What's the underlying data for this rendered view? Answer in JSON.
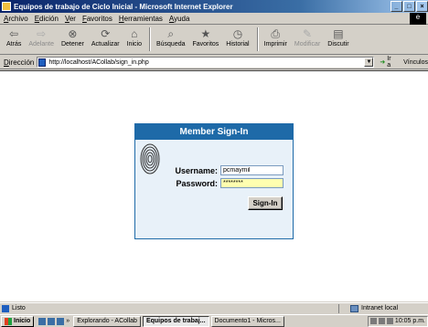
{
  "window": {
    "title": "Equipos de trabajo de Ciclo Inicial - Microsoft Internet Explorer",
    "controls": [
      "_",
      "□",
      "×"
    ]
  },
  "menu": [
    "Archivo",
    "Edición",
    "Ver",
    "Favoritos",
    "Herramientas",
    "Ayuda"
  ],
  "toolbar": [
    {
      "label": "Atrás",
      "icon": "back-arrow-icon",
      "glyph": "⇦",
      "enabled": true
    },
    {
      "label": "Adelante",
      "icon": "forward-arrow-icon",
      "glyph": "⇨",
      "enabled": false
    },
    {
      "label": "Detener",
      "icon": "stop-icon",
      "glyph": "⊗",
      "enabled": true
    },
    {
      "label": "Actualizar",
      "icon": "refresh-icon",
      "glyph": "⟳",
      "enabled": true
    },
    {
      "label": "Inicio",
      "icon": "home-icon",
      "glyph": "⌂",
      "enabled": true
    },
    {
      "label": "Búsqueda",
      "icon": "search-icon",
      "glyph": "⌕",
      "enabled": true
    },
    {
      "label": "Favoritos",
      "icon": "favorites-icon",
      "glyph": "★",
      "enabled": true
    },
    {
      "label": "Historial",
      "icon": "history-icon",
      "glyph": "◷",
      "enabled": true
    },
    {
      "label": "Imprimir",
      "icon": "print-icon",
      "glyph": "⎙",
      "enabled": true
    },
    {
      "label": "Modificar",
      "icon": "edit-icon",
      "glyph": "✎",
      "enabled": false
    },
    {
      "label": "Discutir",
      "icon": "discuss-icon",
      "glyph": "▤",
      "enabled": true
    }
  ],
  "address": {
    "label": "Dirección",
    "url": "http://localhost/ACollab/sign_in.php",
    "go_label": "Ir a",
    "links_label": "Vínculos"
  },
  "signin": {
    "title": "Member Sign-In",
    "username_label": "Username:",
    "username_value": "pcmaymil",
    "password_label": "Password:",
    "password_value": "********",
    "button_label": "Sign-In"
  },
  "status": {
    "text": "Listo",
    "zone": "Intranet local"
  },
  "taskbar": {
    "start_label": "Inicio",
    "quicklaunch_more": "»",
    "tasks": [
      {
        "label": "Explorando - ACollab",
        "active": false
      },
      {
        "label": "Equipos de trabaj...",
        "active": true
      },
      {
        "label": "Documento1 - Micros...",
        "active": false
      }
    ],
    "clock": "10:05 p.m."
  },
  "colors": {
    "panel_header": "#1e6aa8",
    "panel_bg": "#e8f1f9",
    "password_bg": "#ffffb0",
    "title_gradient_start": "#0a246a"
  }
}
